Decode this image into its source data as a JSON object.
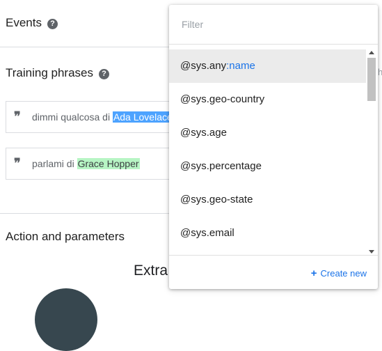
{
  "sections": {
    "events_title": "Events",
    "training_title": "Training phrases",
    "action_title": "Action and parameters",
    "help_glyph": "?"
  },
  "phrases": [
    {
      "text": "dimmi qualcosa di ",
      "entity": "Ada Lovelace"
    },
    {
      "text": "parlami di ",
      "entity": "Grace Hopper"
    }
  ],
  "extract_text": "Extra",
  "side_hint": "h",
  "dropdown": {
    "filter_placeholder": "Filter",
    "items": [
      {
        "label": "@sys.any",
        "suffix": ":name"
      },
      {
        "label": "@sys.geo-country",
        "suffix": ""
      },
      {
        "label": "@sys.age",
        "suffix": ""
      },
      {
        "label": "@sys.percentage",
        "suffix": ""
      },
      {
        "label": "@sys.geo-state",
        "suffix": ""
      },
      {
        "label": "@sys.email",
        "suffix": ""
      }
    ],
    "create_new_label": "Create new",
    "plus_glyph": "+"
  },
  "colors": {
    "accent": "#1a73e8",
    "highlight_blue": "#4da3ff",
    "highlight_green": "#b7f5c4"
  },
  "icons": {
    "help": "help-circle-icon",
    "quote": "quote-icon",
    "plus": "plus-icon"
  }
}
